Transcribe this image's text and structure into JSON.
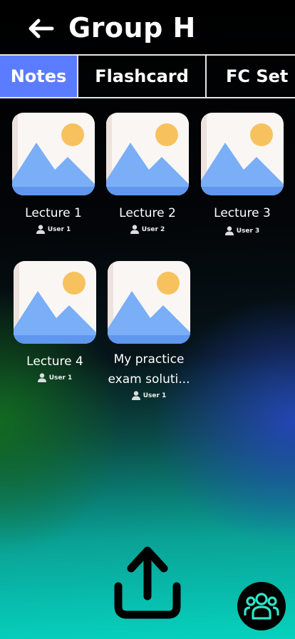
{
  "header": {
    "title": "Group H"
  },
  "tabs": [
    {
      "label": "Notes",
      "active": true
    },
    {
      "label": "Flashcard",
      "active": false
    },
    {
      "label": "FC Set",
      "active": false
    }
  ],
  "notes": [
    {
      "title": "Lecture 1",
      "author": "User 1"
    },
    {
      "title": "Lecture 2",
      "author": "User 2"
    },
    {
      "title": "Lecture 3",
      "author": "User 3"
    },
    {
      "title": "Lecture 4",
      "author": "User 1"
    },
    {
      "title": "My practice exam soluti...",
      "author": "User 1"
    }
  ],
  "colors": {
    "accent": "#5b7cff",
    "group_icon": "#2ee6c8"
  },
  "icons": [
    "back-arrow-icon",
    "image-placeholder-icon",
    "person-icon",
    "upload-icon",
    "group-icon"
  ]
}
